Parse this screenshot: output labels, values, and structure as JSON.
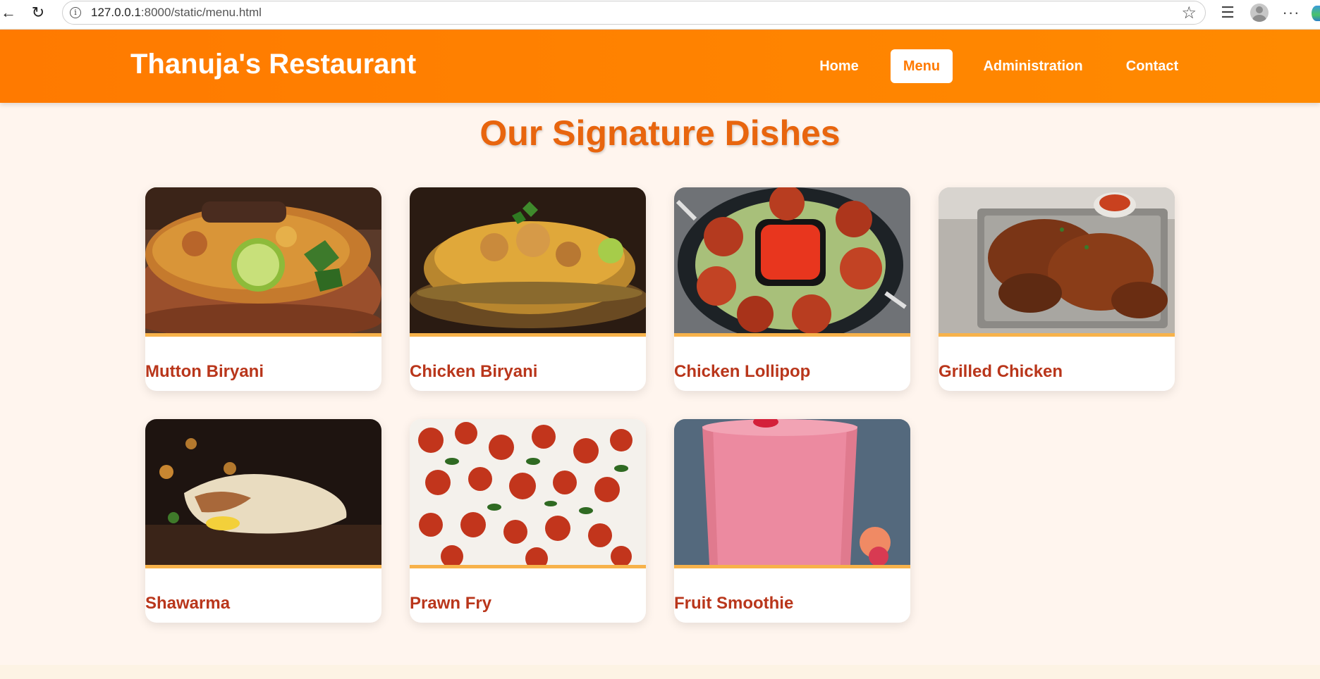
{
  "browser": {
    "url_host": "127.0.0.1",
    "url_path": ":8000/static/menu.html",
    "icons": [
      "back-icon",
      "reload-icon",
      "info-icon",
      "star-icon",
      "favorites-icon",
      "profile-icon",
      "more-icon"
    ]
  },
  "header": {
    "brand": "Thanuja's Restaurant",
    "nav": [
      {
        "label": "Home",
        "active": false
      },
      {
        "label": "Menu",
        "active": true
      },
      {
        "label": "Administration",
        "active": false
      },
      {
        "label": "Contact",
        "active": false
      }
    ]
  },
  "main": {
    "title": "Our Signature Dishes",
    "dishes": [
      {
        "name": "Mutton Biryani"
      },
      {
        "name": "Chicken Biryani"
      },
      {
        "name": "Chicken Lollipop"
      },
      {
        "name": "Grilled Chicken"
      },
      {
        "name": "Shawarma"
      },
      {
        "name": "Prawn Fry"
      },
      {
        "name": "Fruit Smoothie"
      }
    ]
  },
  "colors": {
    "header": "#ff7a00",
    "title": "#e8650e",
    "dish_name": "#b9361b",
    "card_accent": "#f7b24a",
    "page_bg": "#fff5ee"
  }
}
